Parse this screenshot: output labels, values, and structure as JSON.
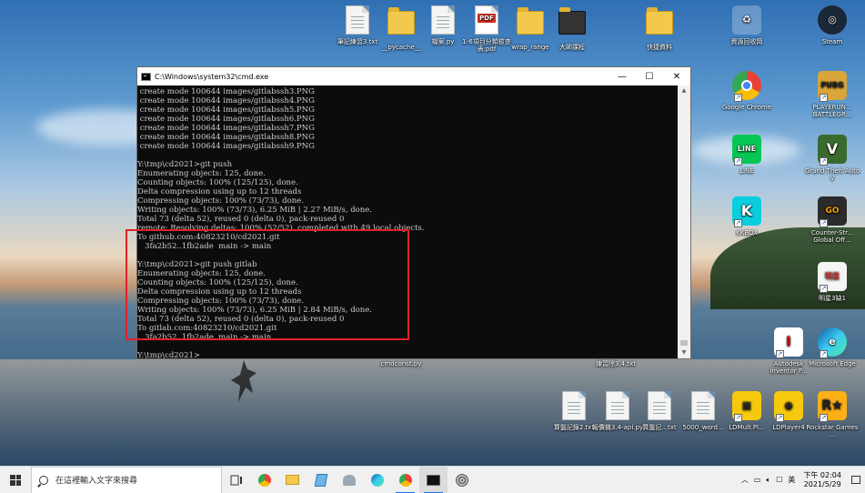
{
  "desktop": {
    "icons": [
      {
        "id": "txt-1",
        "label": "筆記練習3.txt",
        "kind": "file"
      },
      {
        "id": "pycache",
        "label": "__pycache__",
        "kind": "folder"
      },
      {
        "id": "py-file",
        "label": "檔案.py",
        "kind": "file"
      },
      {
        "id": "pdf-file",
        "label": "1-6項目分類檢查表.pdf",
        "kind": "pdf"
      },
      {
        "id": "wrap-folder",
        "label": "wrap_range",
        "kind": "folder"
      },
      {
        "id": "folder-2",
        "label": "大師課程",
        "kind": "folder"
      },
      {
        "id": "folder-3",
        "label": "快捷資料",
        "kind": "folder"
      },
      {
        "id": "recycle",
        "label": "資源回收筒",
        "kind": "app"
      },
      {
        "id": "steam",
        "label": "Steam",
        "kind": "app"
      },
      {
        "id": "chrome",
        "label": "Google Chrome",
        "kind": "app"
      },
      {
        "id": "pubg",
        "label": "PLAYERUN... BATTLEGR...",
        "kind": "app"
      },
      {
        "id": "line",
        "label": "LINE",
        "kind": "app"
      },
      {
        "id": "gta",
        "label": "Grand Theft Auto V",
        "kind": "app"
      },
      {
        "id": "kkbox",
        "label": "KKBOX",
        "kind": "app"
      },
      {
        "id": "csgo",
        "label": "Counter-Str... Global Off...",
        "kind": "app"
      },
      {
        "id": "app-3",
        "label": "明星3缺1",
        "kind": "app"
      },
      {
        "id": "autodesk",
        "label": "Autodesk Inventor P...",
        "kind": "app"
      },
      {
        "id": "edge",
        "label": "Microsoft Edge",
        "kind": "app"
      },
      {
        "id": "cmdconst",
        "label": "cmdconst.py",
        "kind": "text"
      },
      {
        "id": "txt-34",
        "label": "練習除3.4.txt",
        "kind": "text"
      },
      {
        "id": "txt-2",
        "label": "算盤記錄2.txt",
        "kind": "file"
      },
      {
        "id": "py-api",
        "label": "報價機3.4-api.py",
        "kind": "file"
      },
      {
        "id": "txt-calc",
        "label": "算盤記...txt",
        "kind": "file"
      },
      {
        "id": "txt-5000",
        "label": "5000_word...",
        "kind": "file"
      },
      {
        "id": "ldmulti",
        "label": "LDMult.Pl...",
        "kind": "app"
      },
      {
        "id": "ldplayer",
        "label": "LDPlayer4",
        "kind": "app"
      },
      {
        "id": "rockstar",
        "label": "Rockstar Games ...",
        "kind": "app"
      }
    ]
  },
  "cmd": {
    "title": "C:\\Windows\\system32\\cmd.exe",
    "minimize": "—",
    "maximize": "☐",
    "close": "✕",
    "lines": [
      " create mode 100644 images/gitlabssh3.PNG",
      " create mode 100644 images/gitlabssh4.PNG",
      " create mode 100644 images/gitlabssh5.PNG",
      " create mode 100644 images/gitlabssh6.PNG",
      " create mode 100644 images/gitlabssh7.PNG",
      " create mode 100644 images/gitlabssh8.PNG",
      " create mode 100644 images/gitlabssh9.PNG",
      "",
      "Y:\\tmp\\cd2021>git push",
      "Enumerating objects: 125, done.",
      "Counting objects: 100% (125/125), done.",
      "Delta compression using up to 12 threads",
      "Compressing objects: 100% (73/73), done.",
      "Writing objects: 100% (73/73), 6.25 MiB | 2.27 MiB/s, done.",
      "Total 73 (delta 52), reused 0 (delta 0), pack-reused 0",
      "remote: Resolving deltas: 100% (52/52), completed with 49 local objects.",
      "To github.com:40823210/cd2021.git",
      "   3fa2b52..1fb2ade  main -> main",
      "",
      "Y:\\tmp\\cd2021>git push gitlab",
      "Enumerating objects: 125, done.",
      "Counting objects: 100% (125/125), done.",
      "Delta compression using up to 12 threads",
      "Compressing objects: 100% (73/73), done.",
      "Writing objects: 100% (73/73), 6.25 MiB | 2.84 MiB/s, done.",
      "Total 73 (delta 52), reused 0 (delta 0), pack-reused 0",
      "To gitlab.com:40823210/cd2021.git",
      "   3fa2b52..1fb2ade  main -> main",
      "",
      "Y:\\tmp\\cd2021>"
    ]
  },
  "taskbar": {
    "search_placeholder": "在這裡輸入文字來搜尋",
    "tray_lang": "英",
    "time": "下午 02:04",
    "date": "2021/5/29"
  },
  "colors": {
    "highlight_border": "#e0222a",
    "cmd_bg": "#0c0c0c",
    "cmd_text": "#cccccc"
  }
}
